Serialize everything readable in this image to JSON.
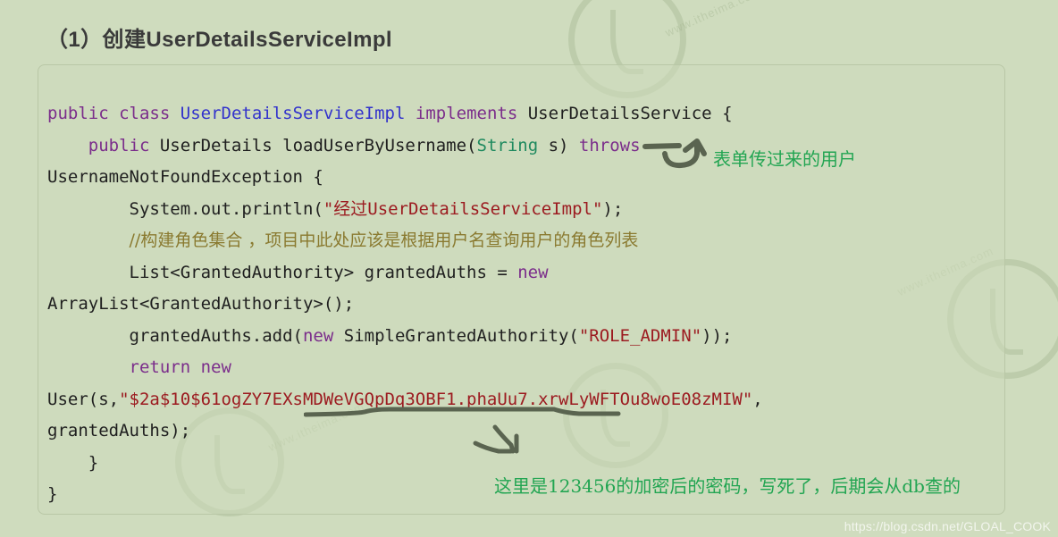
{
  "page": {
    "title": "（1）创建UserDetailsServiceImpl",
    "background_color": "#cfdcbe",
    "code_block_border_color": "#b9c7a6"
  },
  "code": {
    "language": "java",
    "colors": {
      "keyword": "#7b2d8b",
      "class_name": "#3333cc",
      "type": "#1f8a5f",
      "string": "#9c1b20",
      "comment": "#8a7a30",
      "plain": "#1f1f1f"
    },
    "tokens": {
      "kw_public_1": "public",
      "kw_class": "class",
      "cls_name": "UserDetailsServiceImpl",
      "kw_implements": "implements",
      "iface_name": "UserDetailsService",
      "brace_open_1": " {",
      "kw_public_2": "public",
      "ret_type": "UserDetails",
      "method_name": "loadUserByUsername(",
      "type_string": "String",
      "param_name": " s)",
      "kw_throws": "throws",
      "exception_name": "UsernameNotFoundException {",
      "println_call": "System.out.println(",
      "println_arg": "\"经过UserDetailsServiceImpl\"",
      "println_end": ");",
      "comment_line": "//构建角色集合 ，项目中此处应该是根据用户名查询用户的角色列表",
      "list_decl": "List<GrantedAuthority> grantedAuths = ",
      "kw_new_1": "new",
      "arraylist_new": "ArrayList<GrantedAuthority>();",
      "add_call": "grantedAuths.add(",
      "kw_new_2": "new",
      "authority_ctor": " SimpleGrantedAuthority(",
      "role_literal": "\"ROLE_ADMIN\"",
      "add_end": "));",
      "kw_return": "return",
      "kw_new_3": "new",
      "user_ctor": "User(s,",
      "password_hash": "\"$2a$10$61ogZY7EXsMDWeVGQpDq3OBF1.phaUu7.xrwLyWFTOu8woE08zMIW\"",
      "user_ctor_comma": ",",
      "granted_auths_arg": "grantedAuths);",
      "brace_close_inner": "}",
      "brace_close_outer": "}"
    }
  },
  "annotations": {
    "form_user_note": "表单传过来的用户",
    "password_note": "这里是123456的加密后的密码，写死了，后期会从db查的",
    "ink_color": "#5a6450",
    "note_color": "#22a552"
  },
  "watermarks": {
    "csdn_url": "https://blog.csdn.net/GLOAL_COOK",
    "site_text": "www.itheima.com"
  }
}
